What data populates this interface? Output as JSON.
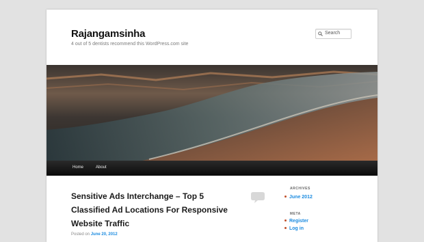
{
  "header": {
    "site_title": "Rajangamsinha",
    "site_description": "4 out of 5 dentists recommend this WordPress.com site",
    "search": {
      "placeholder": "Search"
    }
  },
  "nav": {
    "items": [
      {
        "label": "Home"
      },
      {
        "label": "About"
      }
    ]
  },
  "post": {
    "title_lines": [
      "Sensitive Ads Interchange – Top 5",
      "Classified Ad Locations For Responsive",
      "Website Traffic"
    ],
    "posted_prefix": "Posted on",
    "posted_date": "June 20, 2012"
  },
  "sidebar": {
    "archives": {
      "title": "ARCHIVES",
      "items": [
        {
          "label": "June 2012"
        }
      ]
    },
    "meta": {
      "title": "META",
      "items": [
        {
          "label": "Register"
        },
        {
          "label": "Log in"
        }
      ]
    }
  },
  "colors": {
    "link": "#1b8be0",
    "nav_background": "#111111",
    "bullet": "#c0502b"
  },
  "icons": {
    "search": "search-icon",
    "comment": "comment-bubble-icon"
  }
}
